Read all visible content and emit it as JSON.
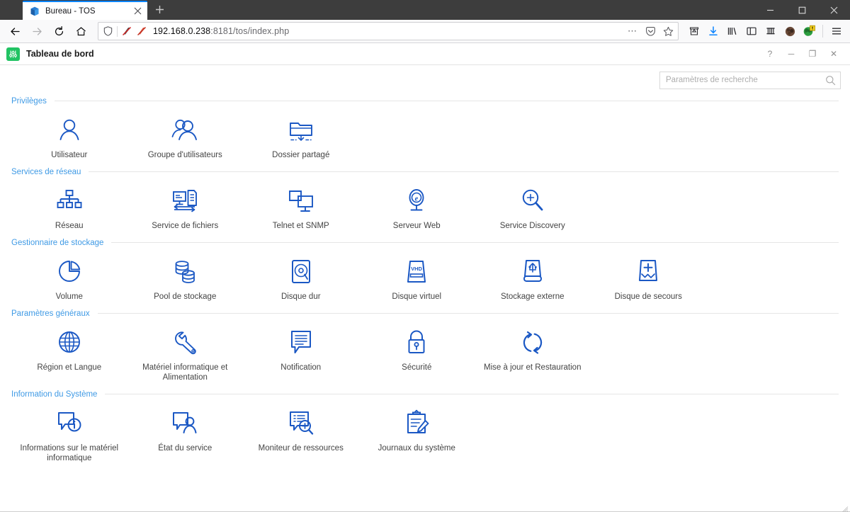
{
  "browser": {
    "tab": {
      "title": "Bureau - TOS",
      "favicon_icon": "tos-cube-icon",
      "close_icon": "close-icon"
    },
    "new_tab_icon": "plus-icon",
    "window_controls": [
      {
        "name": "minimize-window-button",
        "icon": "minimize-icon",
        "glyph": "─"
      },
      {
        "name": "maximize-window-button",
        "icon": "maximize-icon",
        "glyph": "□"
      },
      {
        "name": "close-window-button",
        "icon": "close-icon",
        "glyph": "✕"
      }
    ],
    "nav": [
      {
        "name": "back-button",
        "icon": "arrow-left-icon"
      },
      {
        "name": "forward-button",
        "icon": "arrow-right-icon"
      },
      {
        "name": "reload-button",
        "icon": "reload-icon"
      },
      {
        "name": "home-button",
        "icon": "home-icon"
      }
    ],
    "url": {
      "host": "192.168.0.238",
      "rest": ":8181/tos/index.php",
      "full": "192.168.0.238:8181/tos/index.php"
    },
    "url_icons": [
      {
        "name": "tracking-protection-shield-icon",
        "icon": "shield-icon"
      },
      {
        "name": "no-script-icon",
        "icon": "noscript-icon"
      },
      {
        "name": "ublock-icon",
        "icon": "ublock-icon"
      },
      {
        "name": "page-actions-button",
        "icon": "ellipsis-icon",
        "glyph": "•••"
      },
      {
        "name": "pocket-save-button",
        "icon": "pocket-icon"
      },
      {
        "name": "bookmark-star-button",
        "icon": "star-icon"
      }
    ],
    "toolbar_icons": [
      {
        "name": "save-to-pocket-button",
        "icon": "pocket-archive-icon"
      },
      {
        "name": "downloads-button",
        "icon": "download-arrow-icon"
      },
      {
        "name": "library-button",
        "icon": "library-icon"
      },
      {
        "name": "sidebar-button",
        "icon": "sidebar-icon"
      },
      {
        "name": "extension-grid-button",
        "icon": "grid-icon"
      },
      {
        "name": "account-avatar-button",
        "icon": "avatar-icon"
      },
      {
        "name": "extension-globe-button",
        "icon": "globe-badge-icon",
        "badge": "!"
      },
      {
        "name": "app-menu-button",
        "icon": "hamburger-menu-icon"
      }
    ]
  },
  "app": {
    "logo_icon": "tos-sliders-icon",
    "title": "Tableau de bord",
    "window_buttons": [
      {
        "name": "help-button",
        "icon": "question-mark-icon",
        "glyph": "?"
      },
      {
        "name": "minimize-panel-button",
        "icon": "minimize-icon",
        "glyph": "─"
      },
      {
        "name": "restore-panel-button",
        "icon": "restore-icon",
        "glyph": "❐"
      },
      {
        "name": "close-panel-button",
        "icon": "close-icon",
        "glyph": "✕"
      }
    ]
  },
  "search": {
    "placeholder": "Paramètres de recherche",
    "value": "",
    "icon": "search-icon"
  },
  "theme": {
    "icon_blue": "#1b58c4",
    "section_blue": "#3f9ae5",
    "label_gray": "#444444",
    "accent_green": "#21c363",
    "tab_accent": "#0a84ff"
  },
  "sections": [
    {
      "title": "Privilèges",
      "items": [
        {
          "label": "Utilisateur",
          "icon": "user-icon"
        },
        {
          "label": "Groupe d'utilisateurs",
          "icon": "user-group-icon"
        },
        {
          "label": "Dossier partagé",
          "icon": "shared-folder-icon"
        }
      ]
    },
    {
      "title": "Services de réseau",
      "items": [
        {
          "label": "Réseau",
          "icon": "network-tree-icon"
        },
        {
          "label": "Service de fichiers",
          "icon": "file-service-icon"
        },
        {
          "label": "Telnet et SNMP",
          "icon": "telnet-snmp-icon"
        },
        {
          "label": "Serveur Web",
          "icon": "web-server-icon"
        },
        {
          "label": "Service Discovery",
          "icon": "service-discovery-icon"
        }
      ]
    },
    {
      "title": "Gestionnaire de stockage",
      "items": [
        {
          "label": "Volume",
          "icon": "volume-pie-icon"
        },
        {
          "label": "Pool de stockage",
          "icon": "storage-pool-icon"
        },
        {
          "label": "Disque dur",
          "icon": "hard-disk-icon"
        },
        {
          "label": "Disque virtuel",
          "icon": "virtual-disk-icon",
          "badge_text": "VHD"
        },
        {
          "label": "Stockage externe",
          "icon": "external-storage-usb-icon"
        },
        {
          "label": "Disque de secours",
          "icon": "spare-disk-icon"
        }
      ]
    },
    {
      "title": "Paramètres généraux",
      "items": [
        {
          "label": "Région et Langue",
          "icon": "globe-icon"
        },
        {
          "label": "Matériel informatique et Alimentation",
          "icon": "wrench-icon"
        },
        {
          "label": "Notification",
          "icon": "notification-bubble-icon"
        },
        {
          "label": "Sécurité",
          "icon": "lock-icon"
        },
        {
          "label": "Mise à jour et Restauration",
          "icon": "update-restore-icon"
        }
      ]
    },
    {
      "title": "Information du Système",
      "items": [
        {
          "label": "Informations sur le matériel informatique",
          "icon": "hardware-info-icon"
        },
        {
          "label": "État du service",
          "icon": "service-status-icon"
        },
        {
          "label": "Moniteur de ressources",
          "icon": "resource-monitor-icon"
        },
        {
          "label": "Journaux du système",
          "icon": "system-logs-icon"
        }
      ]
    }
  ]
}
